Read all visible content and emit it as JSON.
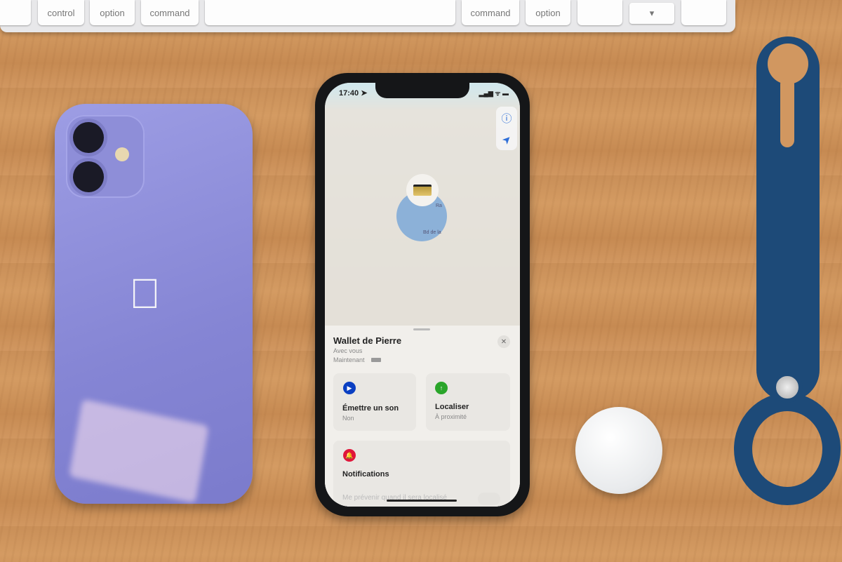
{
  "keyboard": {
    "keys": [
      "control",
      "option",
      "command",
      "command",
      "option"
    ],
    "arrow_down": "▾"
  },
  "status_bar": {
    "time": "17:40 ➤",
    "icons": "▂▄▆ ᯤ ▬"
  },
  "map": {
    "info_icon": "ⓘ",
    "locate_icon": "➤",
    "street_labels": [
      "Ra",
      "Bd de la"
    ]
  },
  "sheet": {
    "title": "Wallet de Pierre",
    "subtitle": "Avec vous",
    "time": "Maintenant",
    "close": "✕",
    "actions": [
      {
        "label": "Émettre un son",
        "sub": "Non",
        "icon": "play-icon",
        "color": "#0a3fc2"
      },
      {
        "label": "Localiser",
        "sub": "À proximité",
        "icon": "arrow-up-icon",
        "color": "#2aa52a"
      }
    ],
    "notifications": {
      "label": "Notifications",
      "icon": "bell-icon",
      "color": "#e0163a",
      "row": "Me prévenir quand il sera localisé"
    }
  }
}
